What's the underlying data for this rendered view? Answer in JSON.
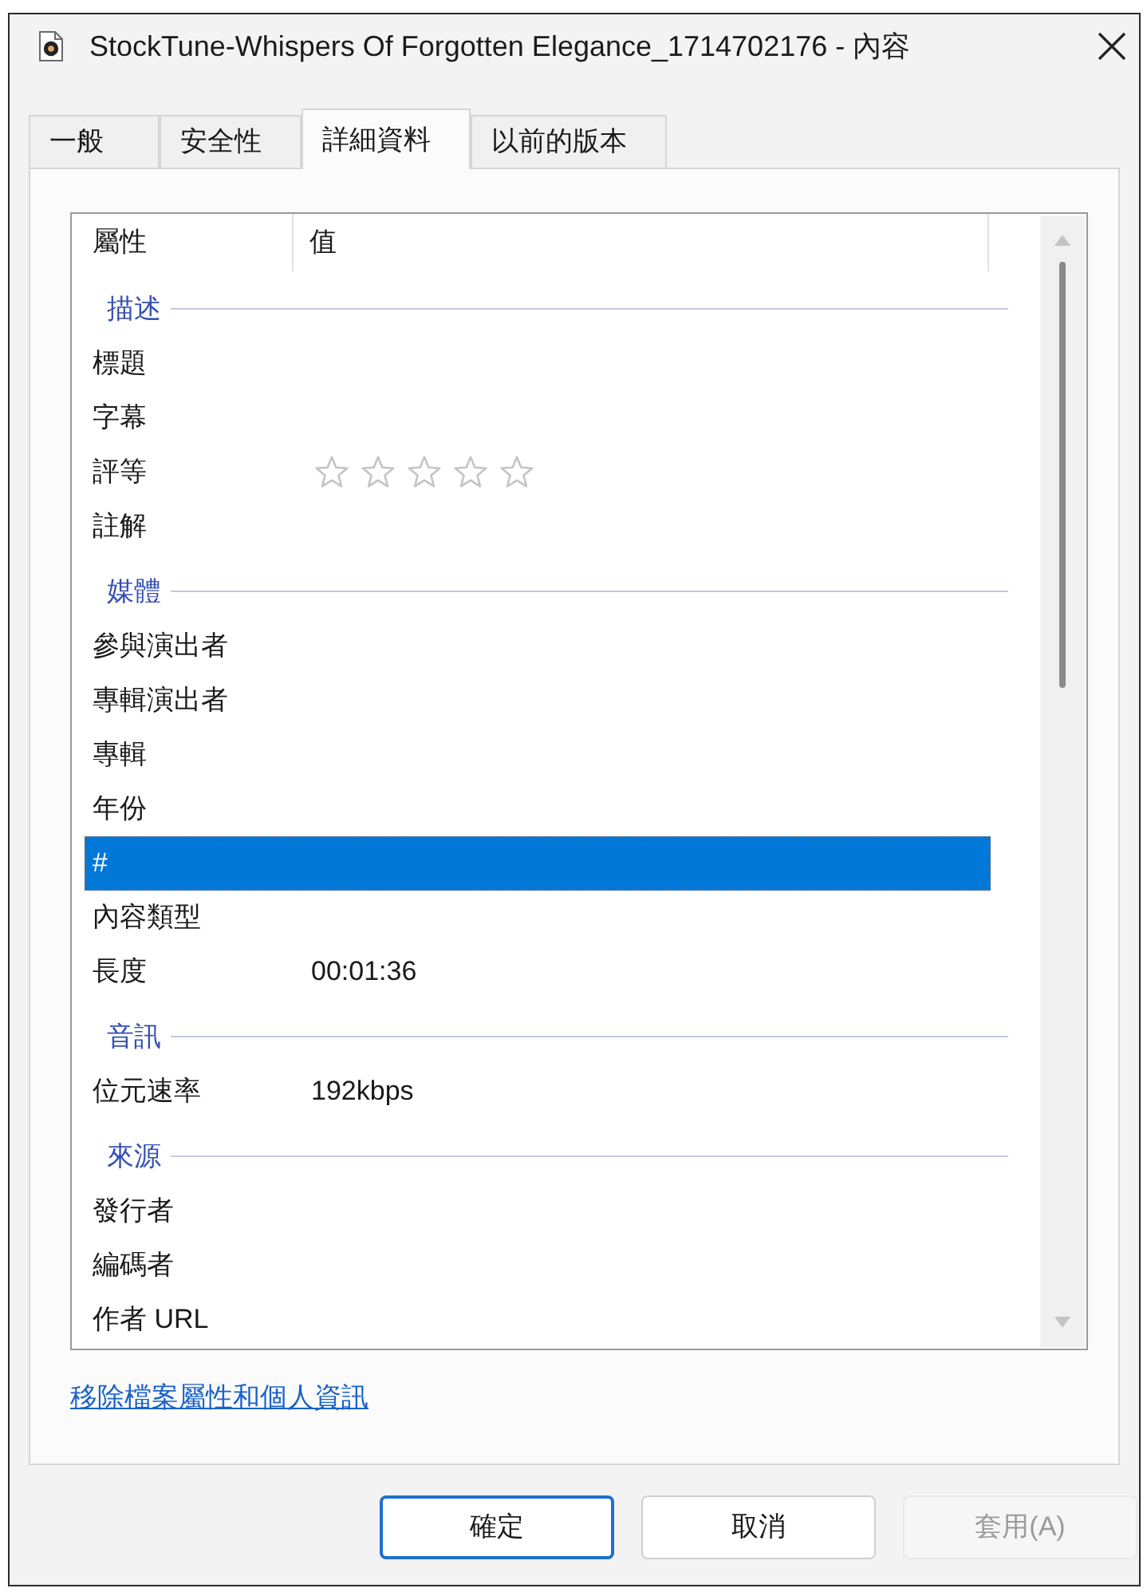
{
  "window": {
    "title": "StockTune-Whispers Of Forgotten Elegance_1714702176 - 內容"
  },
  "tabs": [
    {
      "label": "一般",
      "selected": false
    },
    {
      "label": "安全性",
      "selected": false
    },
    {
      "label": "詳細資料",
      "selected": true
    },
    {
      "label": "以前的版本",
      "selected": false
    }
  ],
  "property_list": {
    "columns": [
      "屬性",
      "值"
    ],
    "rows": [
      {
        "kind": "group",
        "label": "描述"
      },
      {
        "kind": "property",
        "name": "標題",
        "selected": false
      },
      {
        "kind": "property",
        "name": "字幕",
        "selected": false
      },
      {
        "kind": "rating",
        "name": "評等",
        "stars": 0,
        "selected": false
      },
      {
        "kind": "property",
        "name": "註解",
        "selected": false
      },
      {
        "kind": "group",
        "label": "媒體"
      },
      {
        "kind": "property",
        "name": "參與演出者",
        "selected": false
      },
      {
        "kind": "property",
        "name": "專輯演出者",
        "selected": false
      },
      {
        "kind": "property",
        "name": "專輯",
        "selected": false
      },
      {
        "kind": "property",
        "name": "年份",
        "selected": false
      },
      {
        "kind": "property",
        "name": "#",
        "selected": true
      },
      {
        "kind": "property",
        "name": "內容類型",
        "selected": false
      },
      {
        "kind": "property",
        "name": "長度",
        "value": "00:01:36",
        "selected": false
      },
      {
        "kind": "group",
        "label": "音訊"
      },
      {
        "kind": "property",
        "name": "位元速率",
        "value": "192kbps",
        "selected": false
      },
      {
        "kind": "group",
        "label": "來源"
      },
      {
        "kind": "property",
        "name": "發行者",
        "selected": false
      },
      {
        "kind": "property",
        "name": "編碼者",
        "selected": false
      },
      {
        "kind": "property",
        "name": "作者 URL",
        "selected": false
      }
    ]
  },
  "link": "移除檔案屬性和個人資訊",
  "buttons": [
    {
      "label": "確定",
      "default": true,
      "disabled": false
    },
    {
      "label": "取消",
      "default": false,
      "disabled": false
    },
    {
      "label": "套用(A)",
      "default": false,
      "disabled": true
    }
  ]
}
